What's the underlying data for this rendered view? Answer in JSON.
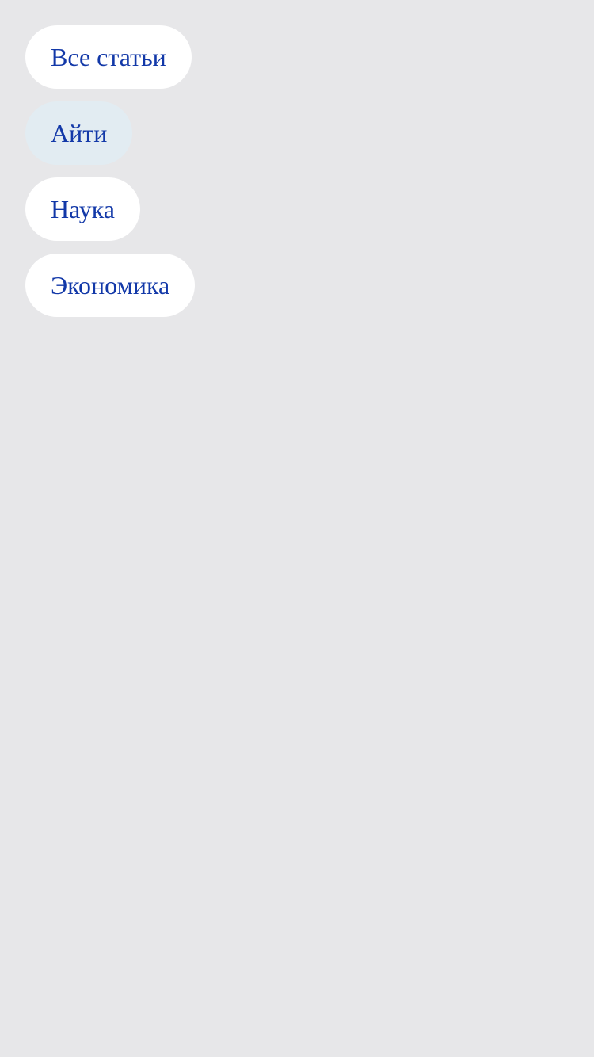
{
  "categories": {
    "items": [
      {
        "label": "Все статьи",
        "active": false
      },
      {
        "label": "Айти",
        "active": true
      },
      {
        "label": "Наука",
        "active": false
      },
      {
        "label": "Экономика",
        "active": false
      }
    ]
  },
  "colors": {
    "background": "#e7e7e9",
    "chip_background": "#ffffff",
    "chip_active_background": "#e2ecf2",
    "chip_text": "#1238a8"
  }
}
